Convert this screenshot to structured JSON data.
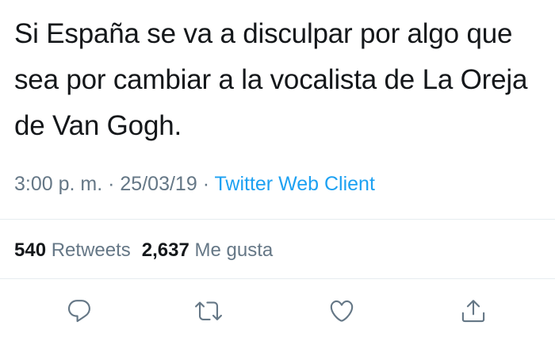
{
  "tweet": {
    "text": "Si España se va a disculpar por algo que sea por cambiar a la vocalista de La Oreja de Van Gogh.",
    "time": "3:00 p. m.",
    "separator": "·",
    "date": "25/03/19",
    "source": "Twitter Web Client"
  },
  "stats": {
    "retweets_count": "540",
    "retweets_label": "Retweets",
    "likes_count": "2,637",
    "likes_label": "Me gusta"
  },
  "actions": {
    "reply_icon": "comment-bubble-icon",
    "retweet_icon": "retweet-arrows-icon",
    "like_icon": "heart-icon",
    "share_icon": "share-upload-icon"
  },
  "colors": {
    "text": "#14171a",
    "muted": "#657786",
    "link": "#1da1f2",
    "divider": "#e6ecf0"
  }
}
